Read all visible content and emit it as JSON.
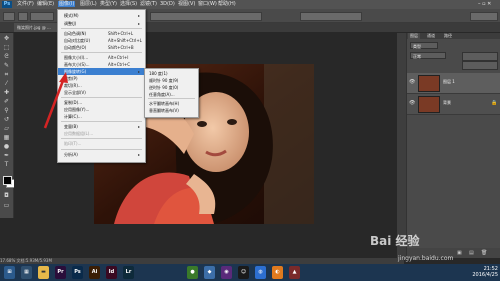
{
  "menubar": {
    "items": [
      "文件(F)",
      "编辑(E)",
      "图像(I)",
      "图层(L)",
      "类型(Y)",
      "选择(S)",
      "滤镜(T)",
      "3D(D)",
      "视图(V)",
      "窗口(W)",
      "帮助(H)"
    ]
  },
  "document_tab": "微笑照片.jpg @ ...",
  "status_bar": "17.68%    文档:5.93M/5.93M",
  "panel": {
    "tabs": [
      "图层",
      "通道",
      "路径"
    ],
    "mode_filter": "类型",
    "blend_mode": "正常",
    "layers": [
      {
        "name": "图层 1"
      },
      {
        "name": "背景"
      }
    ]
  },
  "image_menu": {
    "items": [
      {
        "label": "模式(M)",
        "shortcut": "",
        "submenu": true
      },
      {
        "label": "调整(J)",
        "shortcut": "",
        "submenu": true
      },
      {
        "label": "自动色调(N)",
        "shortcut": "Shift+Ctrl+L"
      },
      {
        "label": "自动对比度(U)",
        "shortcut": "Alt+Shift+Ctrl+L"
      },
      {
        "label": "自动颜色(O)",
        "shortcut": "Shift+Ctrl+B"
      },
      {
        "label": "图像大小(I)...",
        "shortcut": "Alt+Ctrl+I"
      },
      {
        "label": "画布大小(S)...",
        "shortcut": "Alt+Ctrl+C"
      },
      {
        "label": "图像旋转(G)",
        "shortcut": "",
        "submenu": true,
        "highlighted": true
      },
      {
        "label": "裁剪(P)",
        "shortcut": ""
      },
      {
        "label": "裁切(R)...",
        "shortcut": ""
      },
      {
        "label": "显示全部(V)",
        "shortcut": ""
      },
      {
        "label": "复制(D)...",
        "shortcut": ""
      },
      {
        "label": "应用图像(Y)...",
        "shortcut": ""
      },
      {
        "label": "计算(C)...",
        "shortcut": ""
      },
      {
        "label": "变量(B)",
        "shortcut": "",
        "submenu": true
      },
      {
        "label": "应用数据组(L)...",
        "shortcut": "",
        "disabled": true
      },
      {
        "label": "陷印(T)...",
        "shortcut": "",
        "disabled": true
      },
      {
        "label": "分析(A)",
        "shortcut": "",
        "submenu": true
      }
    ]
  },
  "rotate_submenu": {
    "items": [
      "180 度(1)",
      "顺时针 90 度(9)",
      "逆时针 90 度(0)",
      "任意角度(A)...",
      "水平翻转画布(H)",
      "垂直翻转画布(V)"
    ]
  },
  "taskbar": {
    "apps": [
      {
        "label": "Pr",
        "color": "#2a0e3a"
      },
      {
        "label": "Ps",
        "color": "#0a2a4a"
      },
      {
        "label": "Ai",
        "color": "#3a1e06"
      },
      {
        "label": "Id",
        "color": "#3a0a22"
      },
      {
        "label": "Lr",
        "color": "#0e2a3a"
      }
    ],
    "time": "21:52",
    "date": "2016/4/25"
  },
  "watermark": {
    "text": "Bai 经验",
    "url": "jingyan.baidu.com"
  },
  "colors": {
    "highlight": "#3b7fd0",
    "menubar": "#535353"
  }
}
